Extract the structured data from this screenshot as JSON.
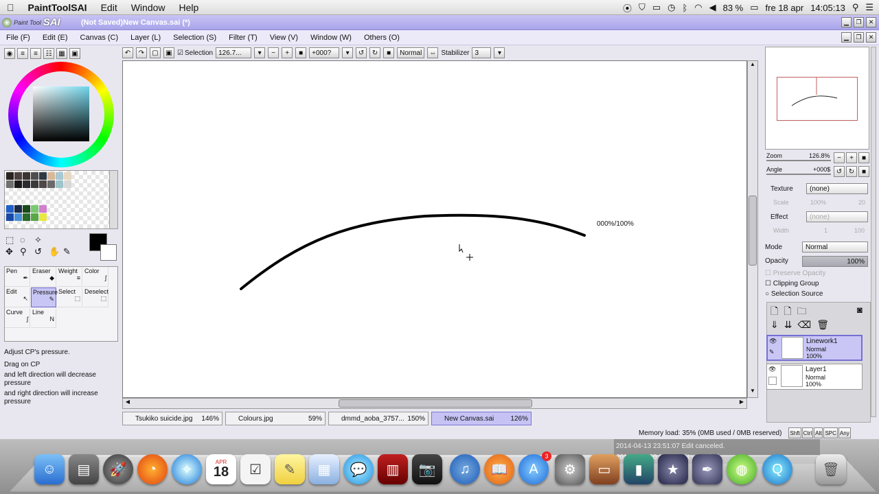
{
  "macbar": {
    "apple": "",
    "app": "PaintToolSAI",
    "menus": [
      "Edit",
      "Window",
      "Help"
    ],
    "battery": "83 %",
    "date": "fre 18 apr",
    "time": "14:05:13"
  },
  "titlebar": {
    "logo_small": "Paint Tool",
    "logo_big": "SAI",
    "title": "(Not Saved)New Canvas.sai (*)"
  },
  "appmenu": [
    "File (F)",
    "Edit (E)",
    "Canvas (C)",
    "Layer (L)",
    "Selection (S)",
    "Filter (T)",
    "View (V)",
    "Window (W)",
    "Others (O)"
  ],
  "toolbar": {
    "selection_label": "Selection",
    "zoom": "126.7...",
    "angle": "+000?",
    "blend": "Normal",
    "stabilizer_label": "Stabilizer",
    "stabilizer_value": "3"
  },
  "tools": [
    {
      "label": "Pen"
    },
    {
      "label": "Eraser"
    },
    {
      "label": "Weight"
    },
    {
      "label": "Color"
    },
    {
      "label": "Edit"
    },
    {
      "label": "Pressure"
    },
    {
      "label": "Select"
    },
    {
      "label": "Deselect"
    },
    {
      "label": "Curve"
    },
    {
      "label": "Line"
    }
  ],
  "hint": {
    "l1": "Adjust CP's pressure.",
    "l2": "Drag on CP",
    "l3": "and left direction will decrease",
    "l4": "pressure",
    "l5": "and right direction will increase",
    "l6": "pressure"
  },
  "canvas": {
    "pressure_readout": "000%/100%"
  },
  "tabs": [
    {
      "name": "Tsukiko suicide.jpg",
      "zoom": "146%"
    },
    {
      "name": "Colours.jpg",
      "zoom": "59%"
    },
    {
      "name": "dmmd_aoba_3757...",
      "zoom": "150%"
    },
    {
      "name": "New Canvas.sai",
      "zoom": "126%"
    }
  ],
  "status": {
    "memory": "Memory load: 35% (0MB used / 0MB reserved)",
    "keys": [
      "Shft",
      "Ctrl",
      "Alt",
      "SPC",
      "Any"
    ]
  },
  "right": {
    "zoom_label": "Zoom",
    "zoom_value": "126.8%",
    "angle_label": "Angle",
    "angle_value": "+000$",
    "texture_label": "Texture",
    "texture_value": "(none)",
    "scale_label": "Scale",
    "scale_value": "100%",
    "scale_num": "20",
    "effect_label": "Effect",
    "effect_value": "(none)",
    "width_label": "Width",
    "width_value": "1",
    "width_num": "100",
    "mode_label": "Mode",
    "mode_value": "Normal",
    "opacity_label": "Opacity",
    "opacity_value": "100%",
    "preserve": "Preserve Opacity",
    "clipping": "Clipping Group",
    "selsource": "Selection Source"
  },
  "layers": [
    {
      "name": "Linework1",
      "mode": "Normal",
      "opacity": "100%"
    },
    {
      "name": "Layer1",
      "mode": "Normal",
      "opacity": "100%"
    }
  ],
  "log": {
    "l1": "2014-04-13 23:51:07 Edit canceled.",
    "l2": "2014-04-1 00:12:05 Edit canceled."
  },
  "dock": {
    "calendar_month": "APR",
    "calendar_day": "18",
    "badge": "3"
  }
}
